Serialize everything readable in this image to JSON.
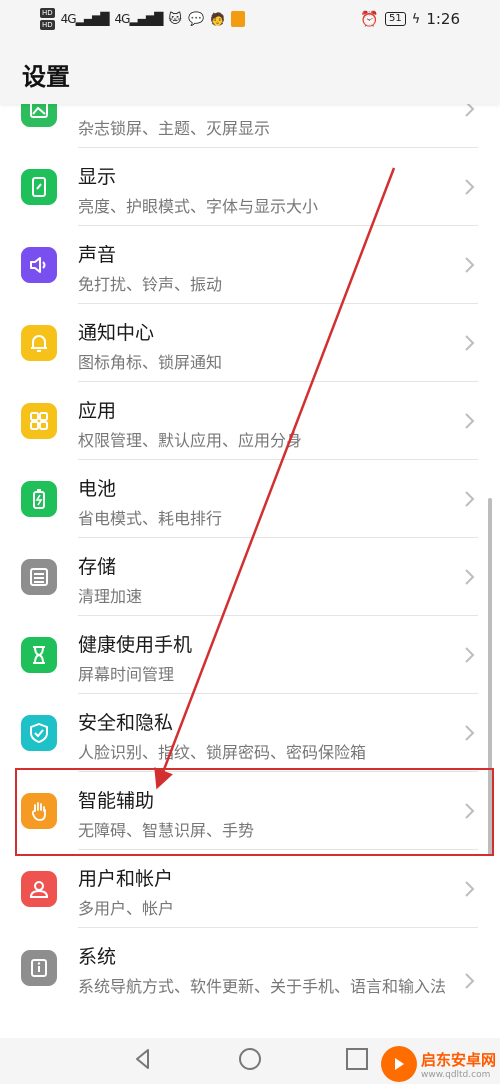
{
  "status_bar": {
    "left_badges": [
      "HD",
      "HD"
    ],
    "left_signals": [
      "4G",
      "4G"
    ],
    "battery": "51",
    "time": "1:26"
  },
  "header": {
    "title": "设置"
  },
  "items": [
    {
      "key": "wallpaper",
      "title": "",
      "sub": "杂志锁屏、主题、灭屏显示",
      "color": "#2ebd5e",
      "icon": "picture-icon"
    },
    {
      "key": "display",
      "title": "显示",
      "sub": "亮度、护眼模式、字体与显示大小",
      "color": "#1fbf5a",
      "icon": "display-icon"
    },
    {
      "key": "sound",
      "title": "声音",
      "sub": "免打扰、铃声、振动",
      "color": "#7a4ff0",
      "icon": "speaker-icon"
    },
    {
      "key": "notifications",
      "title": "通知中心",
      "sub": "图标角标、锁屏通知",
      "color": "#f6c21a",
      "icon": "bell-icon"
    },
    {
      "key": "apps",
      "title": "应用",
      "sub": "权限管理、默认应用、应用分身",
      "color": "#f6c21a",
      "icon": "apps-grid-icon"
    },
    {
      "key": "battery",
      "title": "电池",
      "sub": "省电模式、耗电排行",
      "color": "#1fbf5a",
      "icon": "battery-icon"
    },
    {
      "key": "storage",
      "title": "存储",
      "sub": "清理加速",
      "color": "#8e8e8e",
      "icon": "storage-icon"
    },
    {
      "key": "digital-balance",
      "title": "健康使用手机",
      "sub": "屏幕时间管理",
      "color": "#1fbf5a",
      "icon": "hourglass-icon"
    },
    {
      "key": "security",
      "title": "安全和隐私",
      "sub": "人脸识别、指纹、锁屏密码、密码保险箱",
      "color": "#1ec1c8",
      "icon": "shield-icon"
    },
    {
      "key": "accessibility",
      "title": "智能辅助",
      "sub": "无障碍、智慧识屏、手势",
      "color": "#f59a23",
      "icon": "hand-icon"
    },
    {
      "key": "users",
      "title": "用户和帐户",
      "sub": "多用户、帐户",
      "color": "#ef5350",
      "icon": "user-icon"
    },
    {
      "key": "system",
      "title": "系统",
      "sub": "系统导航方式、软件更新、关于手机、语言和输入法",
      "color": "#8e8e8e",
      "icon": "info-icon"
    }
  ],
  "annotation": {
    "highlight_color": "#d32f2f",
    "target": "智能辅助"
  },
  "nav": [
    "back-icon",
    "home-icon",
    "recents-icon"
  ],
  "watermark": {
    "title": "启东安卓网",
    "url": "www.qdltd.com"
  }
}
